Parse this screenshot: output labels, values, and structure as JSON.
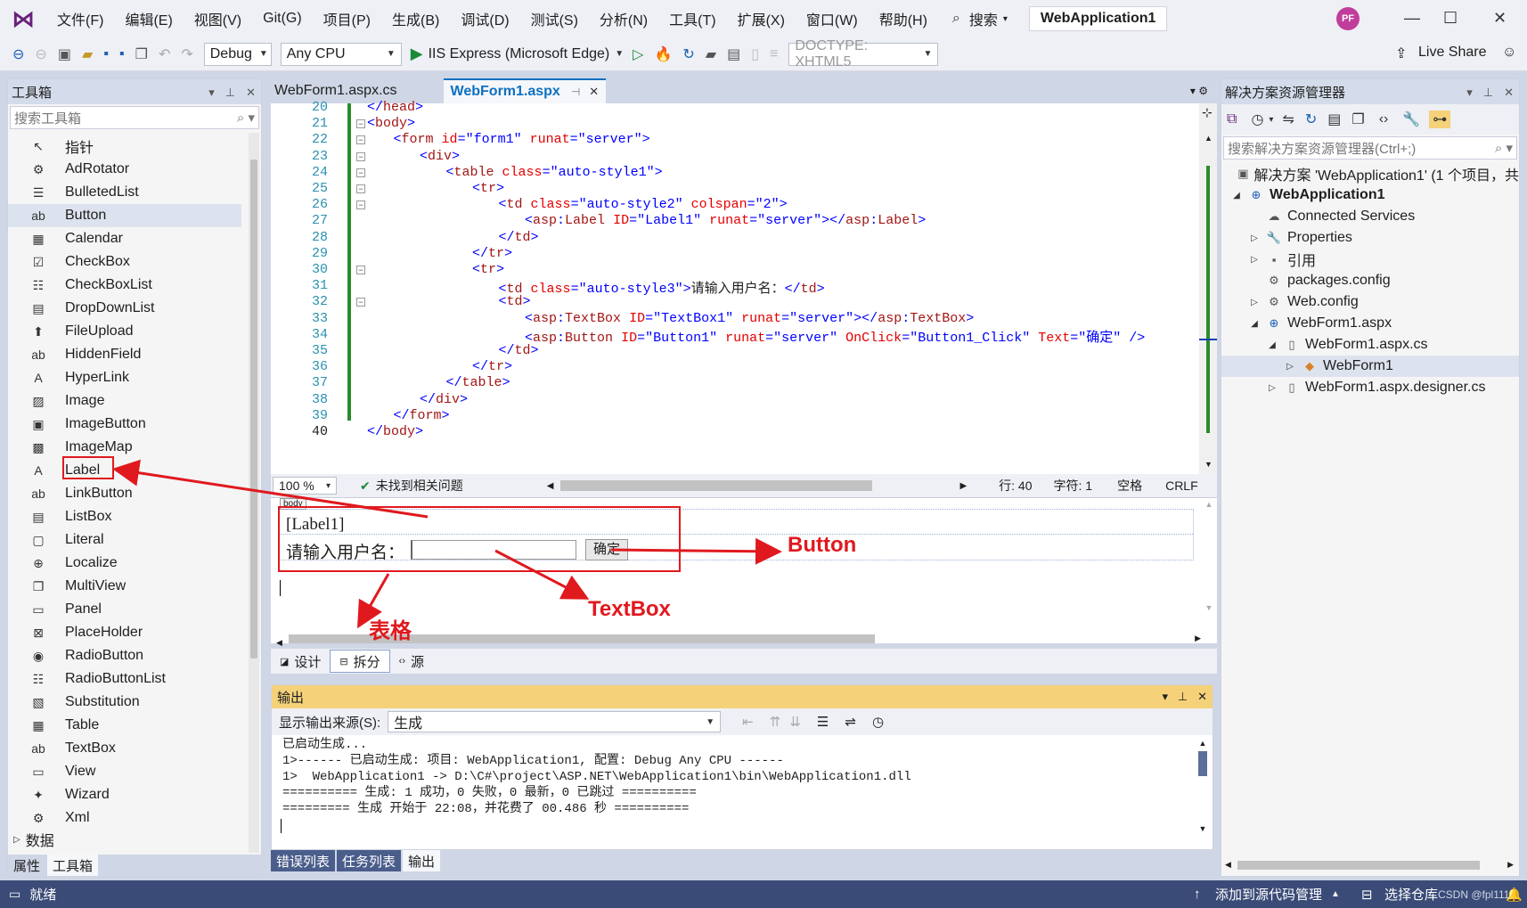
{
  "menu": [
    "文件(F)",
    "编辑(E)",
    "视图(V)",
    "Git(G)",
    "项目(P)",
    "生成(B)",
    "调试(D)",
    "测试(S)",
    "分析(N)",
    "工具(T)",
    "扩展(X)",
    "窗口(W)",
    "帮助(H)"
  ],
  "search_label": "搜索",
  "solution_name": "WebApplication1",
  "avatar_initials": "PF",
  "toolbar": {
    "config": "Debug",
    "platform": "Any CPU",
    "run_label": "IIS Express (Microsoft Edge)",
    "doctype": "DOCTYPE: XHTML5",
    "live_share": "Live Share"
  },
  "toolbox": {
    "title": "工具箱",
    "search_placeholder": "搜索工具箱",
    "items": [
      {
        "label": "指针",
        "icon": "pointer-icon",
        "glyph": "↖"
      },
      {
        "label": "AdRotator",
        "icon": "adrotator-icon",
        "glyph": "⚙"
      },
      {
        "label": "BulletedList",
        "icon": "bulleted-list-icon",
        "glyph": "☰"
      },
      {
        "label": "Button",
        "icon": "button-icon",
        "glyph": "ab"
      },
      {
        "label": "Calendar",
        "icon": "calendar-icon",
        "glyph": "▦"
      },
      {
        "label": "CheckBox",
        "icon": "checkbox-icon",
        "glyph": "☑"
      },
      {
        "label": "CheckBoxList",
        "icon": "checkbox-list-icon",
        "glyph": "☷"
      },
      {
        "label": "DropDownList",
        "icon": "dropdown-list-icon",
        "glyph": "▤"
      },
      {
        "label": "FileUpload",
        "icon": "file-upload-icon",
        "glyph": "⬆"
      },
      {
        "label": "HiddenField",
        "icon": "hidden-field-icon",
        "glyph": "ab"
      },
      {
        "label": "HyperLink",
        "icon": "hyperlink-icon",
        "glyph": "A"
      },
      {
        "label": "Image",
        "icon": "image-icon",
        "glyph": "▨"
      },
      {
        "label": "ImageButton",
        "icon": "image-button-icon",
        "glyph": "▣"
      },
      {
        "label": "ImageMap",
        "icon": "image-map-icon",
        "glyph": "▩"
      },
      {
        "label": "Label",
        "icon": "label-icon",
        "glyph": "A"
      },
      {
        "label": "LinkButton",
        "icon": "link-button-icon",
        "glyph": "ab"
      },
      {
        "label": "ListBox",
        "icon": "listbox-icon",
        "glyph": "▤"
      },
      {
        "label": "Literal",
        "icon": "literal-icon",
        "glyph": "▢"
      },
      {
        "label": "Localize",
        "icon": "localize-icon",
        "glyph": "⊕"
      },
      {
        "label": "MultiView",
        "icon": "multiview-icon",
        "glyph": "❐"
      },
      {
        "label": "Panel",
        "icon": "panel-icon",
        "glyph": "▭"
      },
      {
        "label": "PlaceHolder",
        "icon": "placeholder-icon",
        "glyph": "⊠"
      },
      {
        "label": "RadioButton",
        "icon": "radio-button-icon",
        "glyph": "◉"
      },
      {
        "label": "RadioButtonList",
        "icon": "radio-button-list-icon",
        "glyph": "☷"
      },
      {
        "label": "Substitution",
        "icon": "substitution-icon",
        "glyph": "▧"
      },
      {
        "label": "Table",
        "icon": "table-icon",
        "glyph": "▦"
      },
      {
        "label": "TextBox",
        "icon": "textbox-icon",
        "glyph": "ab"
      },
      {
        "label": "View",
        "icon": "view-icon",
        "glyph": "▭"
      },
      {
        "label": "Wizard",
        "icon": "wizard-icon",
        "glyph": "✦"
      },
      {
        "label": "Xml",
        "icon": "xml-icon",
        "glyph": "⚙"
      }
    ],
    "group_data": "数据",
    "tab_properties": "属性",
    "tab_toolbox": "工具箱"
  },
  "editor": {
    "tab_inactive": "WebForm1.aspx.cs",
    "tab_active": "WebForm1.aspx",
    "lines": [
      {
        "n": "20",
        "html": "<span class='brk'>&lt;/</span><span class='tag'>head</span><span class='brk'>&gt;</span>",
        "indent": 0
      },
      {
        "n": "21",
        "html": "<span class='brk'>&lt;</span><span class='tag'>body</span><span class='brk'>&gt;</span>",
        "indent": 0
      },
      {
        "n": "22",
        "html": "<span class='brk'>&lt;</span><span class='tag'>form</span> <span class='attr'>id</span><span class='brk'>=\"form1\"</span> <span class='attr'>runat</span><span class='brk'>=\"server\"</span><span class='brk'>&gt;</span>",
        "indent": 1
      },
      {
        "n": "23",
        "html": "<span class='brk'>&lt;</span><span class='tag'>div</span><span class='brk'>&gt;</span>",
        "indent": 2
      },
      {
        "n": "24",
        "html": "<span class='brk'>&lt;</span><span class='tag'>table</span> <span class='attr'>class</span><span class='brk'>=\"auto-style1\"</span><span class='brk'>&gt;</span>",
        "indent": 3
      },
      {
        "n": "25",
        "html": "<span class='brk'>&lt;</span><span class='tag'>tr</span><span class='brk'>&gt;</span>",
        "indent": 4
      },
      {
        "n": "26",
        "html": "<span class='brk'>&lt;</span><span class='tag'>td</span> <span class='attr'>class</span><span class='brk'>=\"auto-style2\"</span> <span class='attr'>colspan</span><span class='brk'>=\"2\"</span><span class='brk'>&gt;</span>",
        "indent": 5
      },
      {
        "n": "27",
        "html": "<span class='brk'>&lt;</span><span class='tag'>asp</span><span class='brk'>:</span><span class='tag'>Label</span> <span class='attr'>ID</span><span class='brk'>=\"Label1\"</span> <span class='attr'>runat</span><span class='brk'>=\"server\"</span><span class='brk'>&gt;&lt;/</span><span class='tag'>asp</span><span class='brk'>:</span><span class='tag'>Label</span><span class='brk'>&gt;</span>",
        "indent": 6
      },
      {
        "n": "28",
        "html": "<span class='brk'>&lt;/</span><span class='tag'>td</span><span class='brk'>&gt;</span>",
        "indent": 5
      },
      {
        "n": "29",
        "html": "<span class='brk'>&lt;/</span><span class='tag'>tr</span><span class='brk'>&gt;</span>",
        "indent": 4
      },
      {
        "n": "30",
        "html": "<span class='brk'>&lt;</span><span class='tag'>tr</span><span class='brk'>&gt;</span>",
        "indent": 4
      },
      {
        "n": "31",
        "html": "<span class='brk'>&lt;</span><span class='tag'>td</span> <span class='attr'>class</span><span class='brk'>=\"auto-style3\"</span><span class='brk'>&gt;</span>请输入用户名：<span class='brk'>&lt;/</span><span class='tag'>td</span><span class='brk'>&gt;</span>",
        "indent": 5
      },
      {
        "n": "32",
        "html": "<span class='brk'>&lt;</span><span class='tag'>td</span><span class='brk'>&gt;</span>",
        "indent": 5
      },
      {
        "n": "33",
        "html": "<span class='brk'>&lt;</span><span class='tag'>asp</span><span class='brk'>:</span><span class='tag'>TextBox</span> <span class='attr'>ID</span><span class='brk'>=\"TextBox1\"</span> <span class='attr'>runat</span><span class='brk'>=\"server\"</span><span class='brk'>&gt;&lt;/</span><span class='tag'>asp</span><span class='brk'>:</span><span class='tag'>TextBox</span><span class='brk'>&gt;</span>",
        "indent": 6
      },
      {
        "n": "34",
        "html": "<span class='brk'>&lt;</span><span class='tag'>asp</span><span class='brk'>:</span><span class='tag'>Button</span> <span class='attr'>ID</span><span class='brk'>=\"Button1\"</span> <span class='attr'>runat</span><span class='brk'>=\"server\"</span> <span class='attr'>OnClick</span><span class='brk'>=\"Button1_Click\"</span> <span class='attr'>Text</span><span class='brk'>=\"确定\"</span> <span class='brk'>/&gt;</span>",
        "indent": 6
      },
      {
        "n": "35",
        "html": "<span class='brk'>&lt;/</span><span class='tag'>td</span><span class='brk'>&gt;</span>",
        "indent": 5
      },
      {
        "n": "36",
        "html": "<span class='brk'>&lt;/</span><span class='tag'>tr</span><span class='brk'>&gt;</span>",
        "indent": 4
      },
      {
        "n": "37",
        "html": "<span class='brk'>&lt;/</span><span class='tag'>table</span><span class='brk'>&gt;</span>",
        "indent": 3
      },
      {
        "n": "38",
        "html": "<span class='brk'>&lt;/</span><span class='tag'>div</span><span class='brk'>&gt;</span>",
        "indent": 2
      },
      {
        "n": "39",
        "html": "<span class='brk'>&lt;/</span><span class='tag'>form</span><span class='brk'>&gt;</span>",
        "indent": 1
      },
      {
        "n": "40",
        "html": "<span class='brk'>&lt;/</span><span class='tag'>body</span><span class='brk'>&gt;</span>",
        "indent": 0
      }
    ],
    "zoom": "100 %",
    "issues": "未找到相关问题",
    "line_info": "行: 40",
    "char_info": "字符: 1",
    "spaces": "空格",
    "eol": "CRLF"
  },
  "design": {
    "body_tag": "body",
    "label_text": "[Label1]",
    "prompt_text": "请输入用户名：",
    "button_text": "确定",
    "view_design": "设计",
    "view_split": "拆分",
    "view_source": "源"
  },
  "annotations": {
    "button": "Button",
    "textbox": "TextBox",
    "table": "表格"
  },
  "output": {
    "title": "输出",
    "source_label": "显示输出来源(S):",
    "source_value": "生成",
    "lines": [
      "已启动生成...",
      "1>------ 已启动生成: 项目: WebApplication1, 配置: Debug Any CPU ------",
      "1>  WebApplication1 -> D:\\C#\\project\\ASP.NET\\WebApplication1\\bin\\WebApplication1.dll",
      "========== 生成: 1 成功，0 失败，0 最新，0 已跳过 ==========",
      "========= 生成 开始于 22:08，并花费了 00.486 秒 =========="
    ],
    "tab_errors": "错误列表",
    "tab_tasks": "任务列表",
    "tab_output": "输出"
  },
  "solution_explorer": {
    "title": "解决方案资源管理器",
    "search_placeholder": "搜索解决方案资源管理器(Ctrl+;)",
    "items": [
      {
        "label": "解决方案 'WebApplication1' (1 个项目，共",
        "level": 0,
        "exp": "",
        "icon": "solution-icon",
        "glyph": "▣"
      },
      {
        "label": "WebApplication1",
        "level": 0,
        "exp": "◢",
        "icon": "web-project-icon",
        "glyph": "⊕",
        "bold": true
      },
      {
        "label": "Connected Services",
        "level": 1,
        "exp": "",
        "icon": "connected-services-icon",
        "glyph": "☁"
      },
      {
        "label": "Properties",
        "level": 1,
        "exp": "▷",
        "icon": "wrench-icon",
        "glyph": "🔧"
      },
      {
        "label": "引用",
        "level": 1,
        "exp": "▷",
        "icon": "references-icon",
        "glyph": "▪"
      },
      {
        "label": "packages.config",
        "level": 1,
        "exp": "",
        "icon": "config-file-icon",
        "glyph": "⚙"
      },
      {
        "label": "Web.config",
        "level": 1,
        "exp": "▷",
        "icon": "config-file-icon",
        "glyph": "⚙"
      },
      {
        "label": "WebForm1.aspx",
        "level": 1,
        "exp": "◢",
        "icon": "aspx-file-icon",
        "glyph": "⊕"
      },
      {
        "label": "WebForm1.aspx.cs",
        "level": 2,
        "exp": "◢",
        "icon": "cs-file-icon",
        "glyph": "▯"
      },
      {
        "label": "WebForm1",
        "level": 3,
        "exp": "▷",
        "icon": "class-icon",
        "glyph": "◆",
        "sel": true
      },
      {
        "label": "WebForm1.aspx.designer.cs",
        "level": 2,
        "exp": "▷",
        "icon": "cs-file-icon",
        "glyph": "▯"
      }
    ]
  },
  "status": {
    "ready": "就绪",
    "add_source": "添加到源代码管理",
    "select_repo": "选择仓库",
    "watermark": "CSDN @fpl1116"
  }
}
